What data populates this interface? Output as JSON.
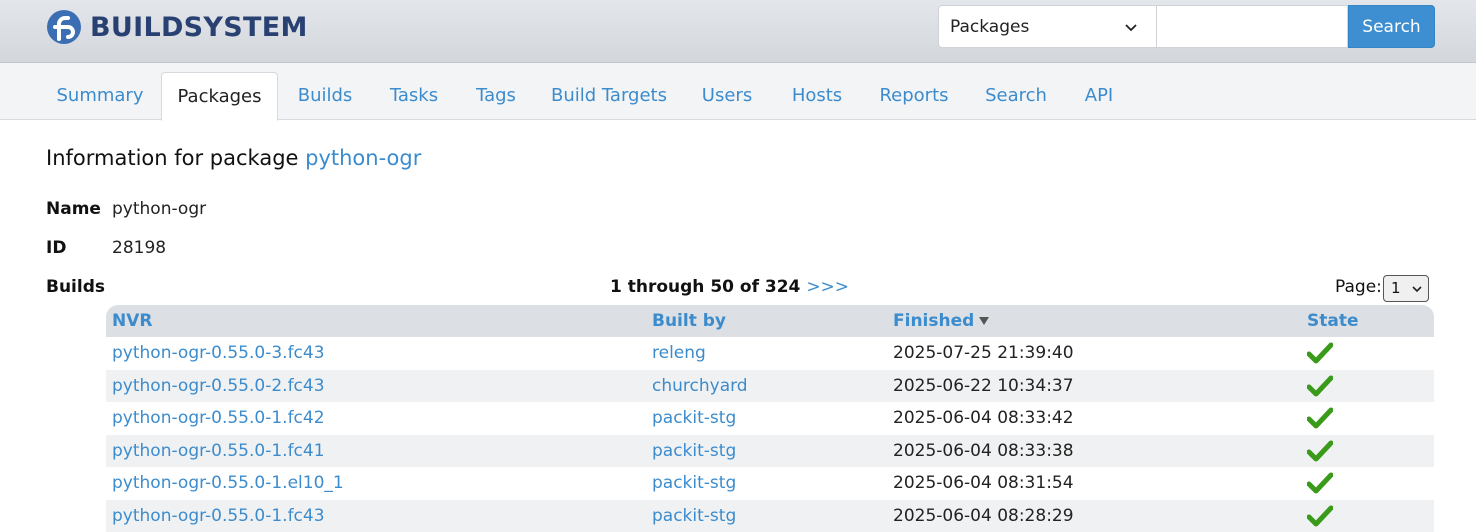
{
  "header": {
    "logo_text": "BUILDSYSTEM",
    "search_select_value": "Packages",
    "search_input_value": "",
    "search_button": "Search"
  },
  "tabs": [
    {
      "label": "Summary",
      "active": false
    },
    {
      "label": "Packages",
      "active": true
    },
    {
      "label": "Builds",
      "active": false
    },
    {
      "label": "Tasks",
      "active": false
    },
    {
      "label": "Tags",
      "active": false
    },
    {
      "label": "Build Targets",
      "active": false
    },
    {
      "label": "Users",
      "active": false
    },
    {
      "label": "Hosts",
      "active": false
    },
    {
      "label": "Reports",
      "active": false
    },
    {
      "label": "Search",
      "active": false
    },
    {
      "label": "API",
      "active": false
    }
  ],
  "page": {
    "heading_prefix": "Information for package ",
    "heading_package": "python-ogr",
    "name_label": "Name",
    "name_value": "python-ogr",
    "id_label": "ID",
    "id_value": "28198",
    "builds_label": "Builds",
    "pager_text": "1 through 50 of 324",
    "pager_next": ">>>",
    "page_label": "Page:",
    "page_value": "1"
  },
  "table": {
    "headers": {
      "nvr": "NVR",
      "built_by": "Built by",
      "finished": "Finished",
      "state": "State"
    },
    "rows": [
      {
        "nvr": "python-ogr-0.55.0-3.fc43",
        "built_by": "releng",
        "finished": "2025-07-25 21:39:40",
        "state": "complete"
      },
      {
        "nvr": "python-ogr-0.55.0-2.fc43",
        "built_by": "churchyard",
        "finished": "2025-06-22 10:34:37",
        "state": "complete"
      },
      {
        "nvr": "python-ogr-0.55.0-1.fc42",
        "built_by": "packit-stg",
        "finished": "2025-06-04 08:33:42",
        "state": "complete"
      },
      {
        "nvr": "python-ogr-0.55.0-1.fc41",
        "built_by": "packit-stg",
        "finished": "2025-06-04 08:33:38",
        "state": "complete"
      },
      {
        "nvr": "python-ogr-0.55.0-1.el10_1",
        "built_by": "packit-stg",
        "finished": "2025-06-04 08:31:54",
        "state": "complete"
      },
      {
        "nvr": "python-ogr-0.55.0-1.fc43",
        "built_by": "packit-stg",
        "finished": "2025-06-04 08:28:29",
        "state": "complete"
      }
    ]
  },
  "colors": {
    "link": "#3c8ccd",
    "brand": "#294172",
    "search_button": "#3d8fd1",
    "check": "#3a9a1a"
  },
  "icons": {
    "logo": "fedora-logo-icon",
    "select_chevron": "chevron-down-icon",
    "sort": "sort-desc-icon",
    "state": "check-icon"
  }
}
